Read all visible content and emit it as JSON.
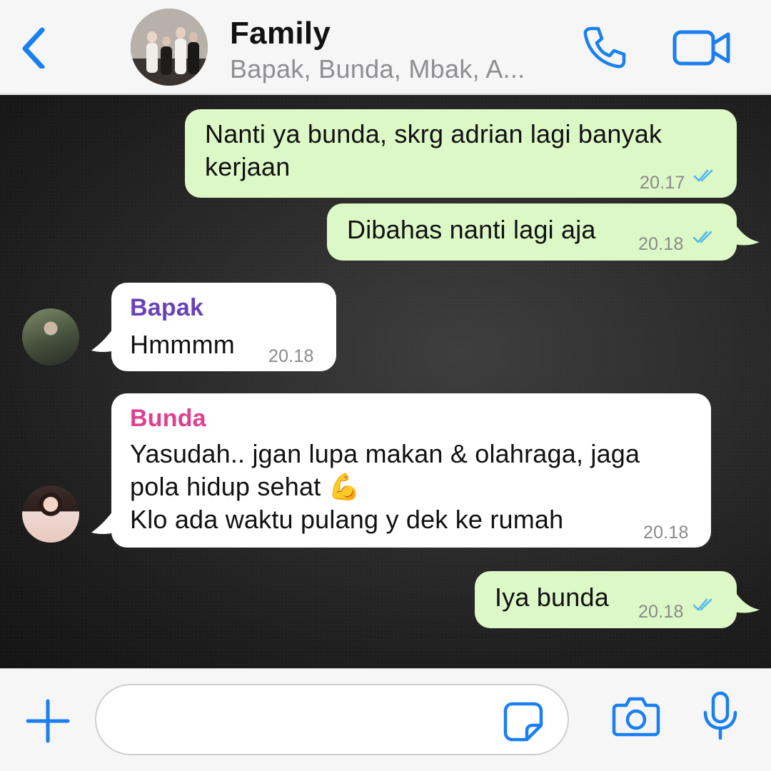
{
  "header": {
    "title": "Family",
    "subtitle": "Bapak, Bunda, Mbak, A...",
    "icons": [
      "chevron-left-icon",
      "phone-icon",
      "video-camera-icon"
    ],
    "accent_color": "#1a7ff0"
  },
  "messages": [
    {
      "direction": "outgoing",
      "text_lines": [
        "Nanti ya bunda, skrg adrian lagi banyak",
        "kerjaan"
      ],
      "time": "20.17",
      "read": true
    },
    {
      "direction": "outgoing",
      "text_lines": [
        "Dibahas nanti lagi aja"
      ],
      "time": "20.18",
      "read": true
    },
    {
      "direction": "incoming",
      "sender": "Bapak",
      "sender_color": "#6a42b8",
      "text_lines": [
        "Hmmmm"
      ],
      "time": "20.18"
    },
    {
      "direction": "incoming",
      "sender": "Bunda",
      "sender_color": "#e03f91",
      "text_lines": [
        "Yasudah.. jgan lupa makan & olahraga, jaga",
        "pola hidup sehat 💪",
        "Klo ada waktu pulang y dek ke rumah"
      ],
      "time": "20.18"
    },
    {
      "direction": "outgoing",
      "text_lines": [
        "Iya bunda"
      ],
      "time": "20.18",
      "read": true
    }
  ],
  "colors": {
    "outgoing_bubble": "#dcf8c6",
    "incoming_bubble": "#ffffff",
    "read_ticks": "#4fb6ec"
  },
  "footer": {
    "input_placeholder": "",
    "icons": [
      "plus-icon",
      "sticker-icon",
      "camera-icon",
      "microphone-icon"
    ]
  }
}
